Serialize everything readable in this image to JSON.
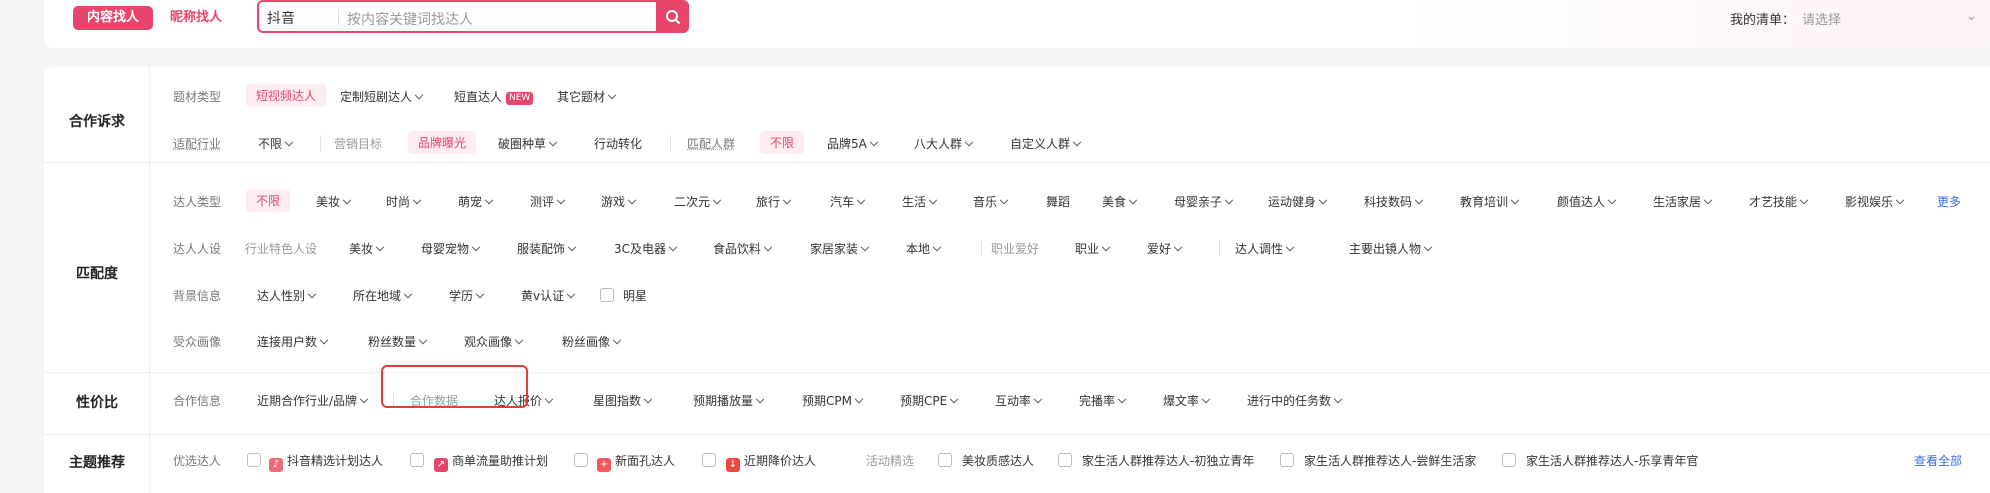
{
  "top": {
    "tab_content": "内容找人",
    "tab_nickname": "昵称找人",
    "platform": "抖音",
    "search_placeholder": "按内容关键词找达人",
    "mylist_label": "我的清单：",
    "mylist_placeholder": "请选择"
  },
  "sections": {
    "cooperation": "合作诉求",
    "match": "匹配度",
    "value": "性价比",
    "theme": "主题推荐"
  },
  "row1": {
    "label": "题材类型",
    "items": [
      "短视频达人",
      "定制短剧达人",
      "短直达人",
      "其它题材"
    ],
    "new_badge": "NEW"
  },
  "row2": {
    "label": "适配行业",
    "unlimited": "不限",
    "label2": "营销目标",
    "goal_items": [
      "品牌曝光",
      "破圈种草",
      "行动转化"
    ],
    "label3": "匹配人群",
    "unlimited2": "不限",
    "crowd_items": [
      "品牌5A",
      "八大人群",
      "自定义人群"
    ]
  },
  "row3": {
    "label": "达人类型",
    "items": [
      "不限",
      "美妆",
      "时尚",
      "萌宠",
      "测评",
      "游戏",
      "二次元",
      "旅行",
      "汽车",
      "生活",
      "音乐",
      "舞蹈",
      "美食",
      "母婴亲子",
      "运动健身",
      "科技数码",
      "教育培训",
      "颜值达人",
      "生活家居",
      "才艺技能",
      "影视娱乐"
    ],
    "more": "更多"
  },
  "row4": {
    "label": "达人人设",
    "sublabel": "行业特色人设",
    "items": [
      "美妆",
      "母婴宠物",
      "服装配饰",
      "3C及电器",
      "食品饮料",
      "家居家装",
      "本地"
    ],
    "sublabel2": "职业爱好",
    "items2": [
      "职业",
      "爱好"
    ],
    "items3": [
      "达人调性",
      "主要出镜人物"
    ]
  },
  "row5": {
    "label": "背景信息",
    "items": [
      "达人性别",
      "所在地域",
      "学历",
      "黄v认证"
    ],
    "checkbox": "明星"
  },
  "row6": {
    "label": "受众画像",
    "items": [
      "连接用户数",
      "粉丝数量",
      "观众画像",
      "粉丝画像"
    ]
  },
  "row7": {
    "label": "合作信息",
    "item": "近期合作行业/品牌",
    "label2": "合作数据",
    "items": [
      "达人报价",
      "星图指数",
      "预期播放量",
      "预期CPM",
      "预期CPE",
      "互动率",
      "完播率",
      "爆文率",
      "进行中的任务数"
    ]
  },
  "row8": {
    "label": "优选达人",
    "items": [
      "抖音精选计划达人",
      "商单流量助推计划",
      "新面孔达人",
      "近期降价达人"
    ],
    "label2": "活动精选",
    "items2": [
      "美妆质感达人",
      "家生活人群推荐达人-初独立青年",
      "家生活人群推荐达人-尝鲜生活家",
      "家生活人群推荐达人-乐享青年官"
    ],
    "view_all": "查看全部"
  }
}
